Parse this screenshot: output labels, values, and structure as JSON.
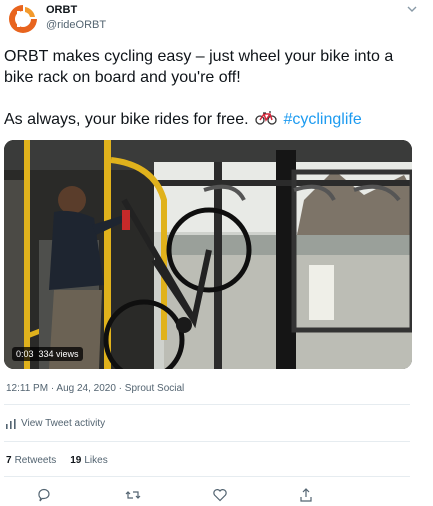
{
  "account": {
    "name": "ORBT",
    "handle": "@rideORBT"
  },
  "tweet": {
    "line1": "ORBT makes cycling easy – just wheel your bike into a bike rack on board and you're off!",
    "line2": "As always, your bike rides for free.",
    "hashtag": "#cyclinglife"
  },
  "video": {
    "duration": "0:03",
    "views": "334 views"
  },
  "meta": {
    "time": "12:11 PM",
    "date": "Aug 24, 2020",
    "source": "Sprout Social"
  },
  "activity_label": "View Tweet activity",
  "stats": {
    "retweets_count": "7",
    "retweets_label": "Retweets",
    "likes_count": "19",
    "likes_label": "Likes"
  },
  "icons": [
    "orbt-logo-icon",
    "chevron-down-icon",
    "bicycle-icon",
    "activity-bars-icon",
    "reply-icon",
    "retweet-icon",
    "like-icon",
    "share-icon"
  ],
  "colors": {
    "brand_orange": "#e8641e",
    "link_blue": "#1d9bf0",
    "secondary_text": "#536471"
  }
}
